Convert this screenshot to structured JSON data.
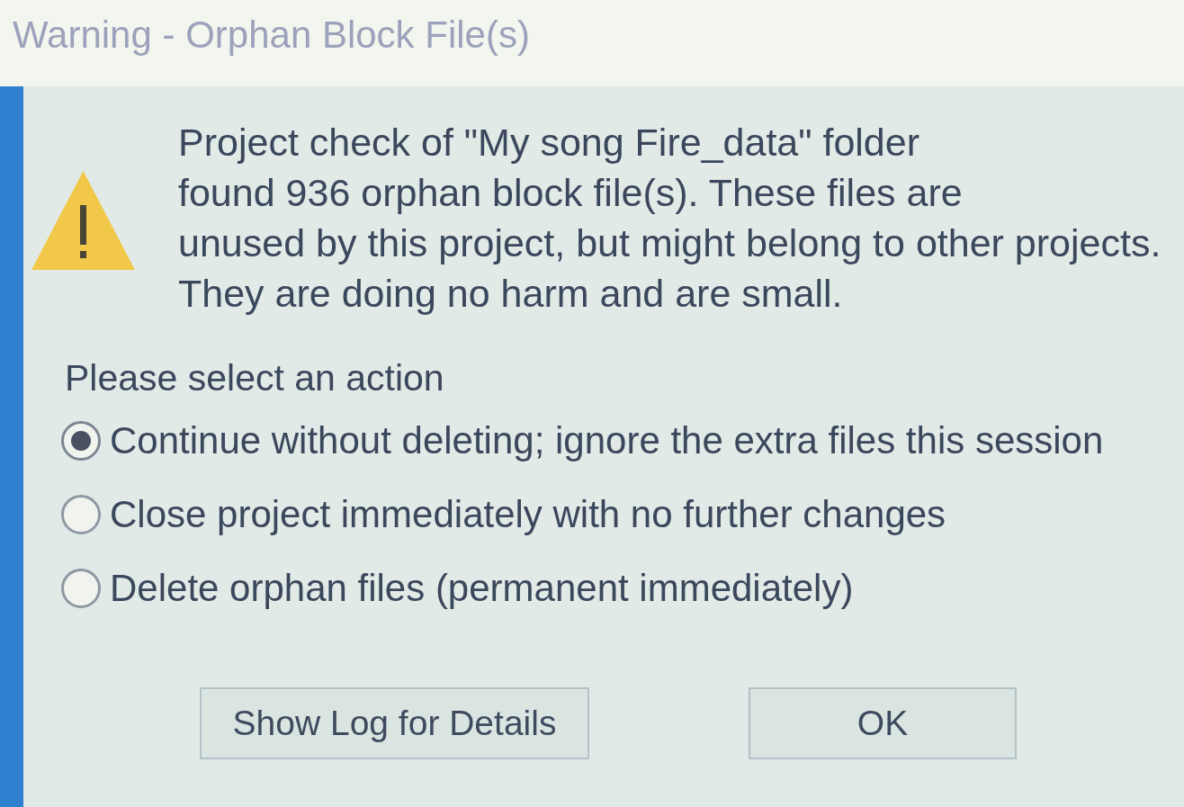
{
  "window": {
    "title": "Warning - Orphan Block File(s)"
  },
  "message": {
    "lines": [
      "Project check of \"My song Fire_data\" folder",
      "found 936 orphan block file(s). These files are",
      "unused by this project, but might belong to other projects.",
      "They are doing no harm and are small."
    ]
  },
  "prompt": "Please select an action",
  "options": [
    {
      "label": "Continue without deleting; ignore the extra files this session",
      "selected": true
    },
    {
      "label": "Close project immediately with no further changes",
      "selected": false
    },
    {
      "label": "Delete orphan files (permanent immediately)",
      "selected": false
    }
  ],
  "buttons": [
    "Show Log for Details",
    "OK"
  ]
}
